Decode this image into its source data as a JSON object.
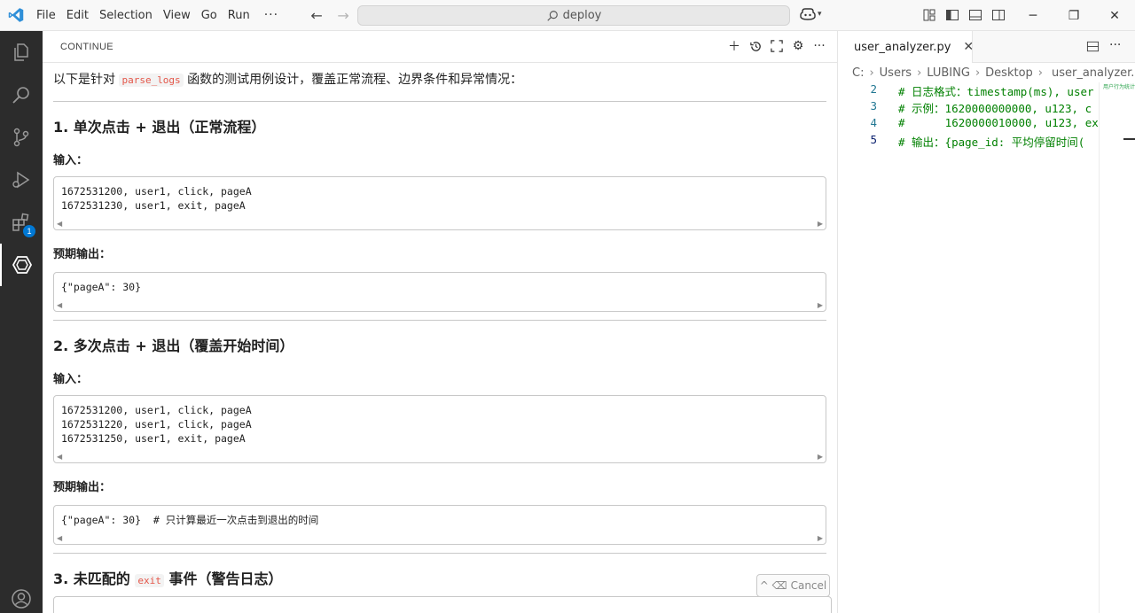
{
  "titlebar": {
    "menu": [
      "File",
      "Edit",
      "Selection",
      "View",
      "Go",
      "Run",
      "···"
    ],
    "search_text": "deploy"
  },
  "activitybar": {
    "extensions_badge": "1"
  },
  "panel": {
    "title": "CONTINUE",
    "intro_before": "以下是针对",
    "intro_code": "parse_logs",
    "intro_after": "函数的测试用例设计，覆盖正常流程、边界条件和异常情况：",
    "sections": [
      {
        "heading": "1. 单次点击 + 退出（正常流程）",
        "input_label": "输入：",
        "input_code": "1672531200, user1, click, pageA\n1672531230, user1, exit, pageA",
        "output_label": "预期输出：",
        "output_code": "{\"pageA\": 30}"
      },
      {
        "heading": "2. 多次点击 + 退出（覆盖开始时间）",
        "input_label": "输入：",
        "input_code": "1672531200, user1, click, pageA\n1672531220, user1, click, pageA\n1672531250, user1, exit, pageA",
        "output_label": "预期输出：",
        "output_code": "{\"pageA\": 30}  # 只计算最近一次点击到退出的时间"
      }
    ],
    "section3_prefix": "3. 未匹配的",
    "section3_code": "exit",
    "section3_suffix": "事件（警告日志）",
    "cancel_label": "Cancel",
    "cancel_keys": "^ ⌫"
  },
  "editor": {
    "tab_label": "user_analyzer.py",
    "breadcrumb": [
      "C:",
      "Users",
      "LUBING",
      "Desktop",
      "user_analyzer.py"
    ],
    "lines": [
      {
        "num": "2",
        "text": "# 日志格式：timestamp(ms), user"
      },
      {
        "num": "3",
        "text": "# 示例：1620000000000, u123, c"
      },
      {
        "num": "4",
        "text": "#      1620000010000, u123, ex"
      },
      {
        "num": "5",
        "text": "# 输出：{page_id: 平均停留时间("
      }
    ],
    "minimap_label": "用户行为统计"
  }
}
